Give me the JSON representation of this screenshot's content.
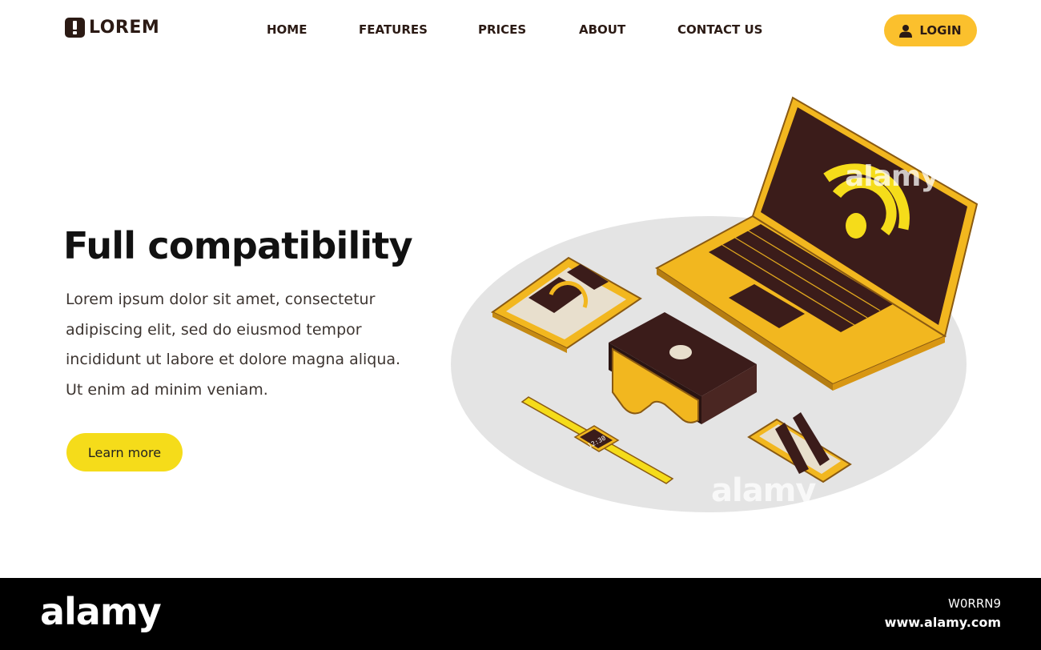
{
  "brand": {
    "logo_text": "LOREM",
    "icon": "exclamation-badge-icon"
  },
  "nav": {
    "items": [
      "HOME",
      "FEATURES",
      "PRICES",
      "ABOUT",
      "CONTACT US"
    ]
  },
  "login": {
    "label": "LOGIN",
    "icon": "user-icon"
  },
  "hero": {
    "title": "Full compatibility",
    "body": "Lorem ipsum dolor sit amet, consectetur adipiscing elit, sed do eiusmod tempor incididunt ut labore et dolore magna aliqua. Ut enim ad minim veniam.",
    "cta_label": "Learn more"
  },
  "illustration": {
    "items": [
      "laptop-icon",
      "tablet-icon",
      "vr-headset-icon",
      "smartwatch-icon",
      "smartphone-icon",
      "wifi-icon"
    ],
    "watch_time": "12:30"
  },
  "footer": {
    "brand": "alamy",
    "image_id": "W0RRN9",
    "url": "www.alamy.com"
  },
  "watermark": "alamy",
  "colors": {
    "accent": "#fbc02d",
    "cta": "#f5dc1a",
    "dark": "#2b1a14",
    "screen": "#3b1c1a",
    "platform": "#e4e4e4",
    "footer": "#000000"
  }
}
